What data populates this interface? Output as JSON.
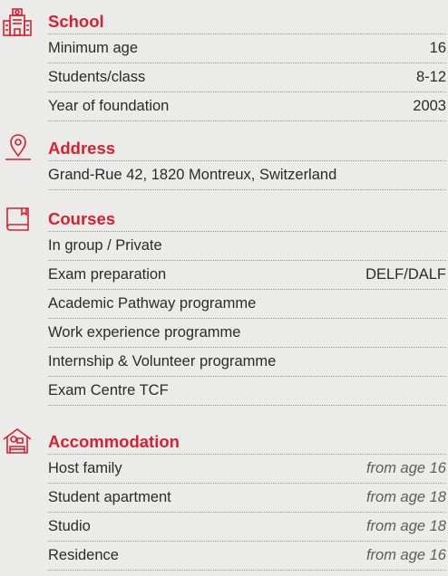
{
  "colors": {
    "accent": "#d8202e",
    "background": "#ebebea",
    "text": "#2b2b2b",
    "muted": "#5d5d5d"
  },
  "school": {
    "icon": "school-building-icon",
    "title": "School",
    "rows": [
      {
        "label": "Minimum age",
        "value": "16"
      },
      {
        "label": "Students/class",
        "value": "8-12"
      },
      {
        "label": "Year of foundation",
        "value": "2003"
      }
    ]
  },
  "address": {
    "icon": "location-pin-icon",
    "title": "Address",
    "rows": [
      {
        "label": "Grand-Rue 42, 1820 Montreux, Switzerland"
      }
    ]
  },
  "courses": {
    "icon": "book-icon",
    "title": "Courses",
    "rows": [
      {
        "label": "In group / Private"
      },
      {
        "label": "Exam preparation",
        "value": "DELF/DALF"
      },
      {
        "label": "Academic Pathway programme"
      },
      {
        "label": "Work experience programme"
      },
      {
        "label": "Internship & Volunteer programme"
      },
      {
        "label": "Exam Centre TCF"
      }
    ]
  },
  "accommodation": {
    "icon": "house-icon",
    "title": "Accommodation",
    "rows": [
      {
        "label": "Host family",
        "value": "from age 16"
      },
      {
        "label": "Student apartment",
        "value": "from age 18"
      },
      {
        "label": "Studio",
        "value": "from age 18"
      },
      {
        "label": "Residence",
        "value": "from age 16"
      }
    ]
  }
}
